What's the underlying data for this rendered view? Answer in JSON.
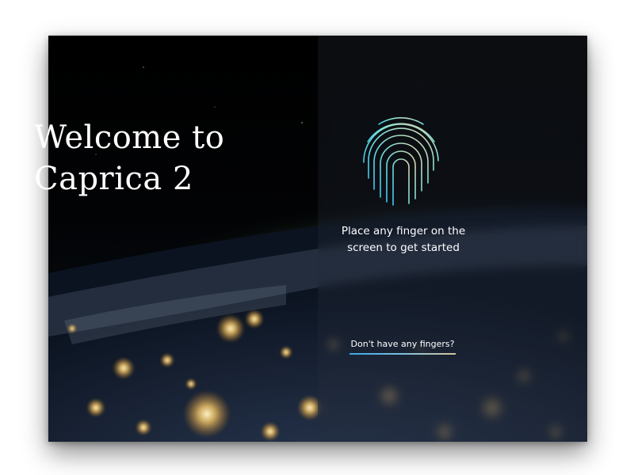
{
  "welcome": {
    "line1": "Welcome to",
    "line2": "Caprica 2"
  },
  "login": {
    "instruction_line1": "Place any finger on the",
    "instruction_line2": "screen to get started",
    "no_fingers_link": "Don't have any fingers?"
  },
  "icons": {
    "fingerprint": "fingerprint-icon"
  },
  "colors": {
    "fingerprint_gradient_start": "#3ec9f0",
    "fingerprint_gradient_mid": "#7fe0d6",
    "fingerprint_gradient_end": "#e6d3a6",
    "link_underline_start": "#3aa6e8",
    "link_underline_end": "#d7c59a",
    "text": "#ffffff"
  }
}
